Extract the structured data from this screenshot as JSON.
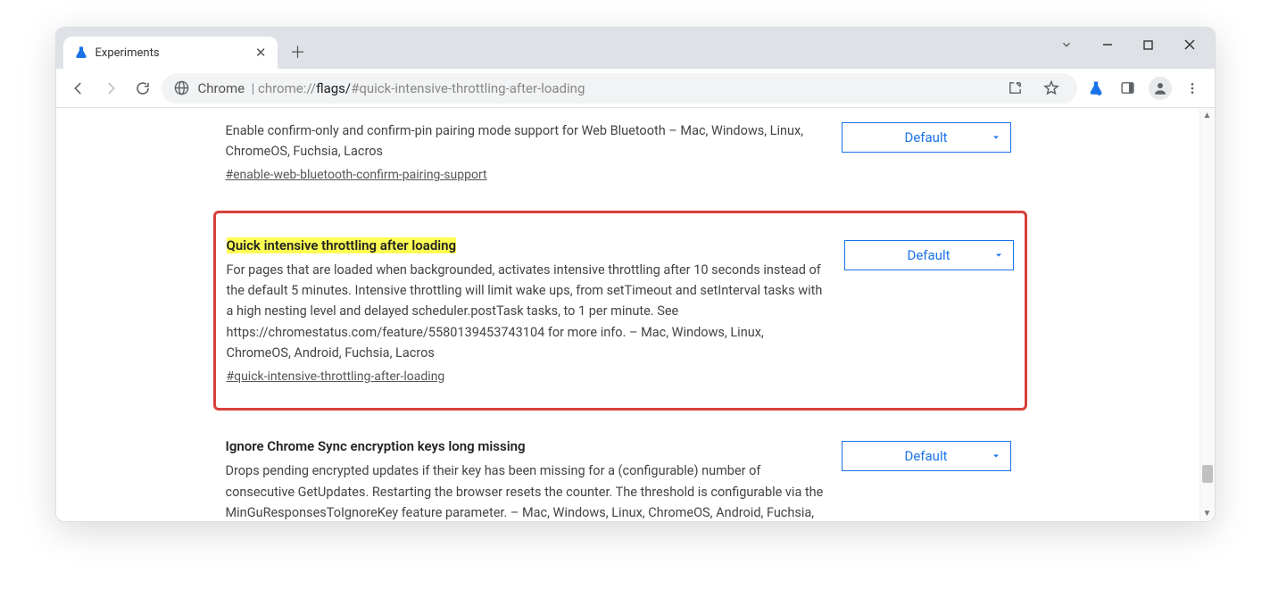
{
  "tab": {
    "title": "Experiments"
  },
  "omnibox": {
    "scheme_label": "Chrome",
    "url_bold": "flags/",
    "url_prefix": "chrome://",
    "url_hash": "#quick-intensive-throttling-after-loading"
  },
  "flags": [
    {
      "title": "",
      "desc": "Enable confirm-only and confirm-pin pairing mode support for Web Bluetooth – Mac, Windows, Linux, ChromeOS, Fuchsia, Lacros",
      "anchor": "#enable-web-bluetooth-confirm-pairing-support",
      "select": "Default",
      "highlighted": false,
      "title_highlight": false
    },
    {
      "title": "Quick intensive throttling after loading",
      "desc": "For pages that are loaded when backgrounded, activates intensive throttling after 10 seconds instead of the default 5 minutes. Intensive throttling will limit wake ups, from setTimeout and setInterval tasks with a high nesting level and delayed scheduler.postTask tasks, to 1 per minute. See https://chromestatus.com/feature/5580139453743104 for more info. – Mac, Windows, Linux, ChromeOS, Android, Fuchsia, Lacros",
      "anchor": "#quick-intensive-throttling-after-loading",
      "select": "Default",
      "highlighted": true,
      "title_highlight": true
    },
    {
      "title": "Ignore Chrome Sync encryption keys long missing",
      "desc": "Drops pending encrypted updates if their key has been missing for a (configurable) number of consecutive GetUpdates. Restarting the browser resets the counter. The threshold is configurable via the MinGuResponsesToIgnoreKey feature parameter. – Mac, Windows, Linux, ChromeOS, Android, Fuchsia, Lacros",
      "anchor": "",
      "select": "Default",
      "highlighted": false,
      "title_highlight": false
    }
  ]
}
